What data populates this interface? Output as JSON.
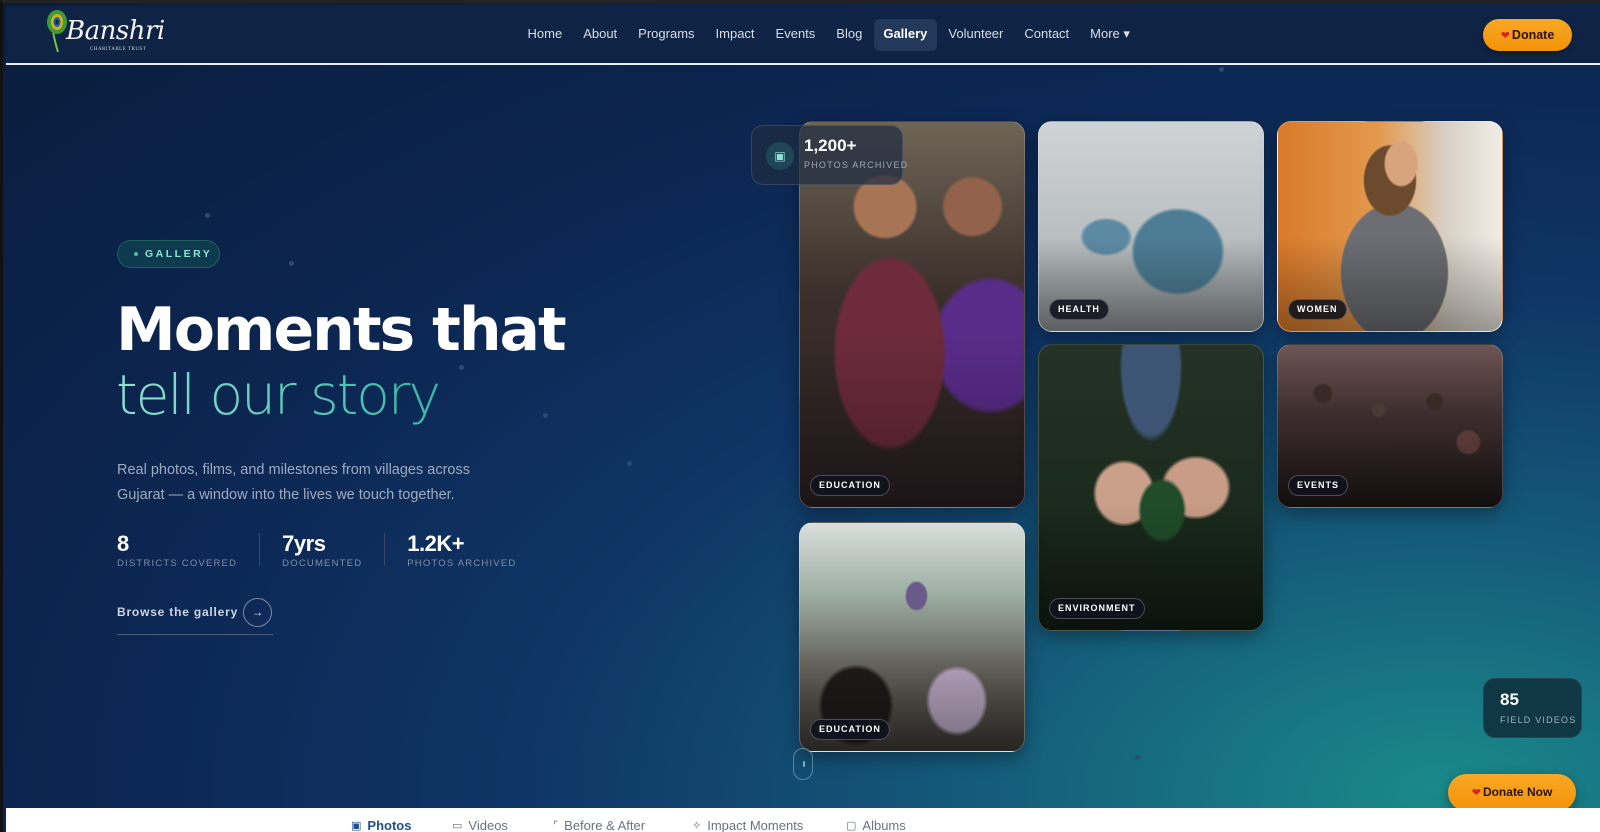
{
  "header": {
    "logo_text": "Banshri",
    "logo_sub": "CHARITABLE TRUST",
    "nav": [
      "Home",
      "About",
      "Programs",
      "Impact",
      "Events",
      "Blog",
      "Gallery",
      "Volunteer",
      "Contact",
      "More ▾"
    ],
    "active_nav": "Gallery",
    "donate_label": "Donate"
  },
  "hero": {
    "pill": "GALLERY",
    "title_line1": "Moments that",
    "title_line2": "tell our story",
    "description": "Real photos, films, and milestones from villages across Gujarat — a window into the lives we touch together.",
    "stats": [
      {
        "value": "8",
        "label": "DISTRICTS COVERED"
      },
      {
        "value": "7yrs",
        "label": "DOCUMENTED"
      },
      {
        "value": "1.2K+",
        "label": "PHOTOS ARCHIVED"
      }
    ],
    "browse_label": "Browse the gallery"
  },
  "gallery": {
    "photos_badge": {
      "value": "1,200+",
      "label": "PHOTOS ARCHIVED"
    },
    "cards": [
      {
        "tag": "EDUCATION"
      },
      {
        "tag": "HEALTH"
      },
      {
        "tag": "WOMEN"
      },
      {
        "tag": "ENVIRONMENT"
      },
      {
        "tag": "EVENTS"
      },
      {
        "tag": "EDUCATION"
      }
    ],
    "videos_badge": {
      "value": "85",
      "label": "FIELD VIDEOS"
    },
    "donate_now_label": "Donate Now"
  },
  "tabs": [
    "Photos",
    "Videos",
    "Before & After",
    "Impact Moments",
    "Albums"
  ],
  "active_tab": "Photos",
  "colors": {
    "accent_teal": "#37b6a9",
    "donate_orange": "#f5a01a",
    "header_bg": "#0f2445",
    "active_tab": "#1f4f8f"
  }
}
